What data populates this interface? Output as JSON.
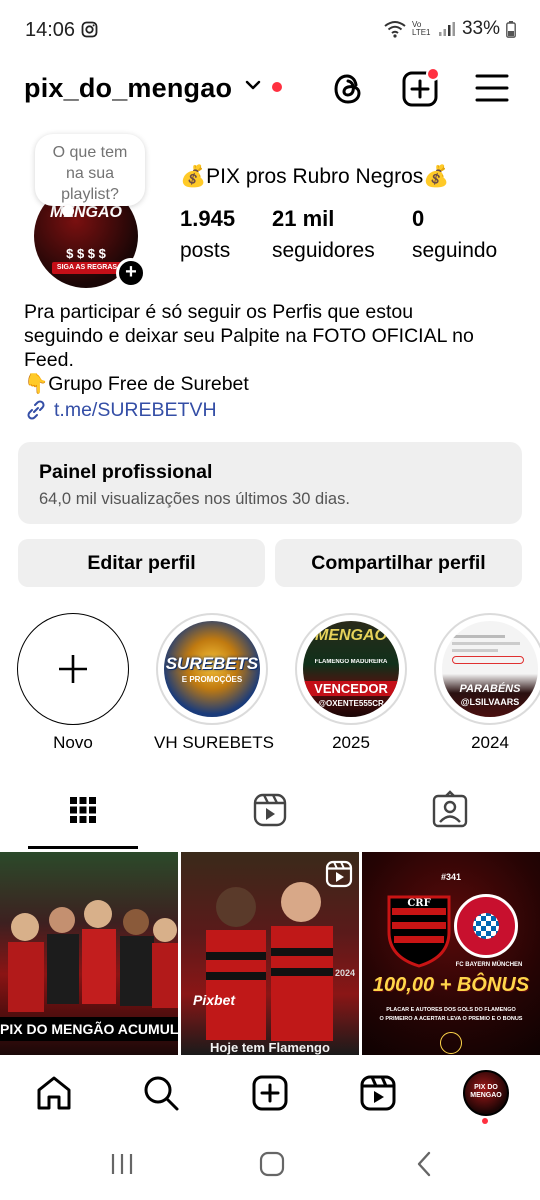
{
  "status_bar": {
    "time": "14:06",
    "network_label": "Vo LTE1",
    "battery": "33%"
  },
  "header": {
    "username": "pix_do_mengao",
    "icons": [
      "chevron-down-icon",
      "threads-icon",
      "create-post-icon",
      "menu-icon"
    ],
    "accent_color": "#ff3040"
  },
  "profile": {
    "note": "O que tem na sua playlist?",
    "note_lines": [
      "O que tem",
      "na sua",
      "playlist?"
    ],
    "avatar_text": "MENGAO",
    "avatar_money": "$ $ $ $",
    "avatar_band": "SIGA AS REGRAS",
    "display_name": "💰PIX pros Rubro Negros💰",
    "stats": [
      {
        "value": "1.945",
        "label": "posts"
      },
      {
        "value": "21 mil",
        "label": "seguidores"
      },
      {
        "value": "0",
        "label": "seguindo"
      }
    ],
    "bio_lines": [
      "Pra participar é só seguir os Perfis que estou",
      "seguindo e deixar seu Palpite na FOTO OFICIAL no",
      "Feed.",
      "👇Grupo Free de Surebet"
    ],
    "link": "t.me/SUREBETVH",
    "link_color": "#344ea6"
  },
  "professional_panel": {
    "title": "Painel profissional",
    "subtitle": "64,0 mil visualizações nos últimos 30 dias."
  },
  "buttons": {
    "edit": "Editar perfil",
    "share": "Compartilhar perfil"
  },
  "highlights": [
    {
      "label": "Novo"
    },
    {
      "label": "VH SUREBETS",
      "art_title": "SUREBETS",
      "art_sub": "E PROMOÇÕES"
    },
    {
      "label": "2025",
      "art_top": "MENGAO",
      "art_mid": "FLAMENGO  MADUREIRA",
      "art_bottom": "VENCEDOR",
      "art_handle": "@OXENTE555CR"
    },
    {
      "label": "2024",
      "art_bottom": "PARABÉNS",
      "art_handle": "@LSILVAARS"
    }
  ],
  "tabs": [
    "grid-icon",
    "reels-icon",
    "tagged-icon"
  ],
  "posts": [
    {
      "caption": "PIX DO MENGÃO ACUMULOU"
    },
    {
      "caption": "Hoje tem Flamengo",
      "badge": "reels-icon",
      "jersey_text": "Pixbet",
      "year": "2024"
    },
    {
      "number": "#341",
      "club": "FC BAYERN MÜNCHEN",
      "caption": "100,00 + BÔNUS",
      "footer_lines": [
        "PLACAR E AUTORES DOS GOLS DO FLAMENGO",
        "O PRIMEIRO A ACERTAR LEVA O PRÊMIO E O BÔNUS"
      ]
    }
  ],
  "bottom_nav": [
    "home-icon",
    "search-icon",
    "create-icon",
    "reels-icon",
    "profile-avatar"
  ],
  "avatar_small_text": "PIX DO MENGAO"
}
